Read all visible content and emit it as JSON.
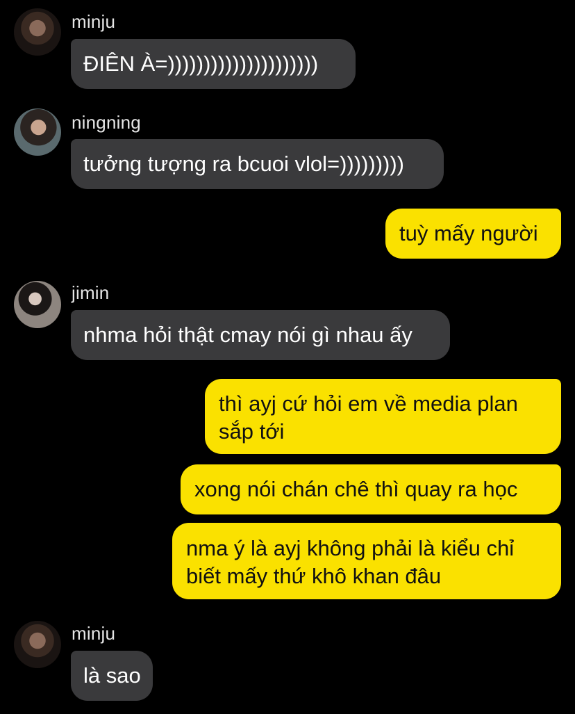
{
  "messages": [
    {
      "sender": "minju",
      "text": "ĐIÊN À=)))))))))))))))))))))"
    },
    {
      "sender": "ningning",
      "text": "tưởng tượng ra bcuoi vlol=)))))))))"
    },
    {
      "me": true,
      "text": "tuỳ mấy người"
    },
    {
      "sender": "jimin",
      "text": "nhma hỏi thật cmay nói gì nhau ấy"
    },
    {
      "me": true,
      "lines": [
        "thì ayj cứ hỏi em về media plan",
        "sắp tới"
      ]
    },
    {
      "me": true,
      "text": "xong nói chán chê thì quay ra học"
    },
    {
      "me": true,
      "lines": [
        "nma ý là ayj không phải là kiểu chỉ",
        "biết mấy thứ khô khan đâu"
      ]
    },
    {
      "sender": "minju",
      "text": "là sao"
    }
  ],
  "colors": {
    "background": "#000000",
    "incoming_bubble": "#3a3a3c",
    "outgoing_bubble": "#fae100"
  }
}
